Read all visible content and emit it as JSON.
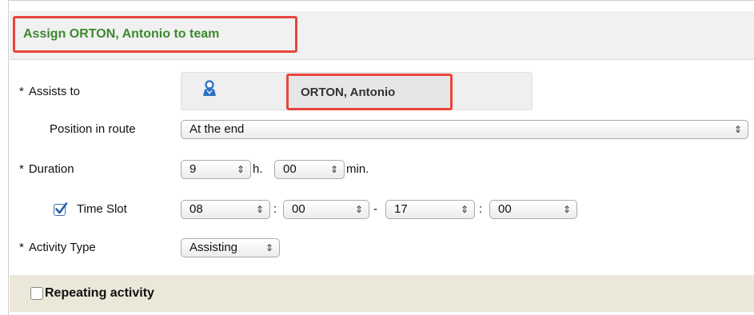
{
  "header": {
    "title": "Assign ORTON, Antonio to team"
  },
  "form": {
    "assists_to": {
      "required_mark": "*",
      "label": "Assists to",
      "person_name": "ORTON, Antonio"
    },
    "position_in_route": {
      "label": "Position in route",
      "value": "At the end"
    },
    "duration": {
      "required_mark": "*",
      "label": "Duration",
      "hours": "9",
      "hours_unit": "h.",
      "minutes": "00",
      "minutes_unit": "min."
    },
    "time_slot": {
      "checked": true,
      "label": "Time Slot",
      "start_hour": "08",
      "start_min": "00",
      "end_hour": "17",
      "end_min": "00",
      "colon": ":",
      "dash": "-"
    },
    "activity_type": {
      "required_mark": "*",
      "label": "Activity Type",
      "value": "Assisting"
    }
  },
  "repeating": {
    "checked": false,
    "label": "Repeating activity"
  },
  "icons": {
    "person": "person-icon",
    "select_arrows": "up-down-arrows-icon",
    "check": "checkmark-icon"
  },
  "colors": {
    "title_green": "#3c8a2e",
    "highlight_red": "#e8453c",
    "repeat_bg": "#ebe8d9",
    "person_blue": "#2b6fc2"
  }
}
